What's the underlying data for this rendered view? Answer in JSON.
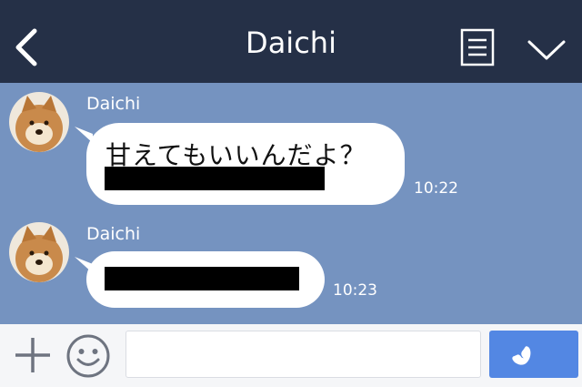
{
  "header": {
    "title": "Daichi",
    "icons": {
      "back": "chevron-left-icon",
      "menu": "document-list-icon",
      "collapse": "chevron-down-icon"
    }
  },
  "messages": [
    {
      "sender": "Daichi",
      "text": "甘えてもいいんだよ？",
      "time": "10:22",
      "redacted": true
    },
    {
      "sender": "Daichi",
      "text": "",
      "time": "10:23",
      "redacted": true
    }
  ],
  "footer": {
    "input_value": "",
    "icons": {
      "add": "plus-icon",
      "emoji": "smiley-icon",
      "call": "phone-icon"
    }
  },
  "colors": {
    "header_bg": "#253047",
    "chat_bg": "#7593c0",
    "bubble_bg": "#ffffff",
    "footer_bg": "#f5f6f8",
    "call_button": "#5387e3"
  }
}
